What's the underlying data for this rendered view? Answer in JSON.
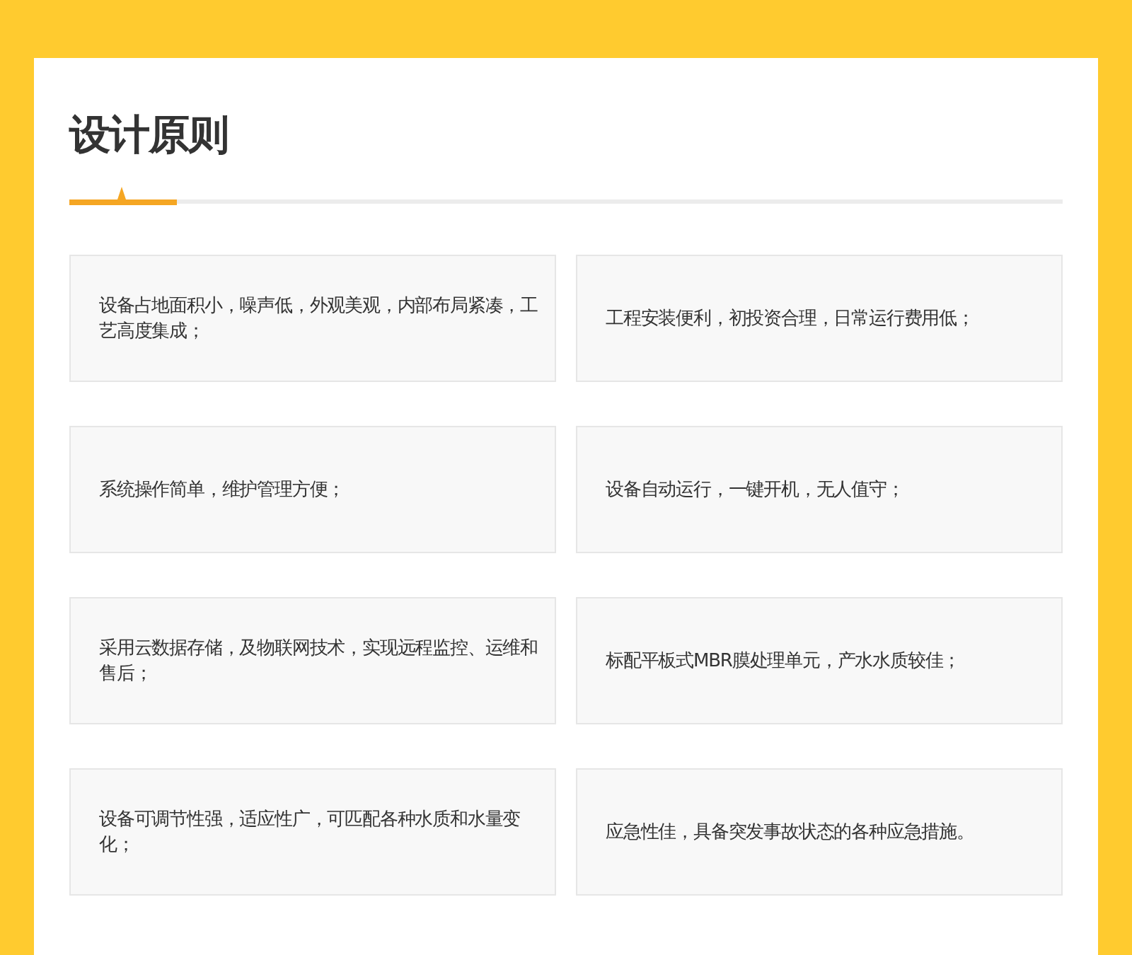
{
  "title": "设计原则",
  "principles": [
    "设备占地面积小，噪声低，外观美观，内部布局紧凑，工艺高度集成；",
    "工程安装便利，初投资合理，日常运行费用低；",
    "系统操作简单，维护管理方便；",
    "设备自动运行，一键开机，无人值守；",
    "采用云数据存储，及物联网技术，实现远程监控、运维和售后；",
    "标配平板式MBR膜处理单元，产水水质较佳；",
    "设备可调节性强，适应性广，可匹配各种水质和水量变化；",
    "应急性佳，具备突发事故状态的各种应急措施。"
  ]
}
